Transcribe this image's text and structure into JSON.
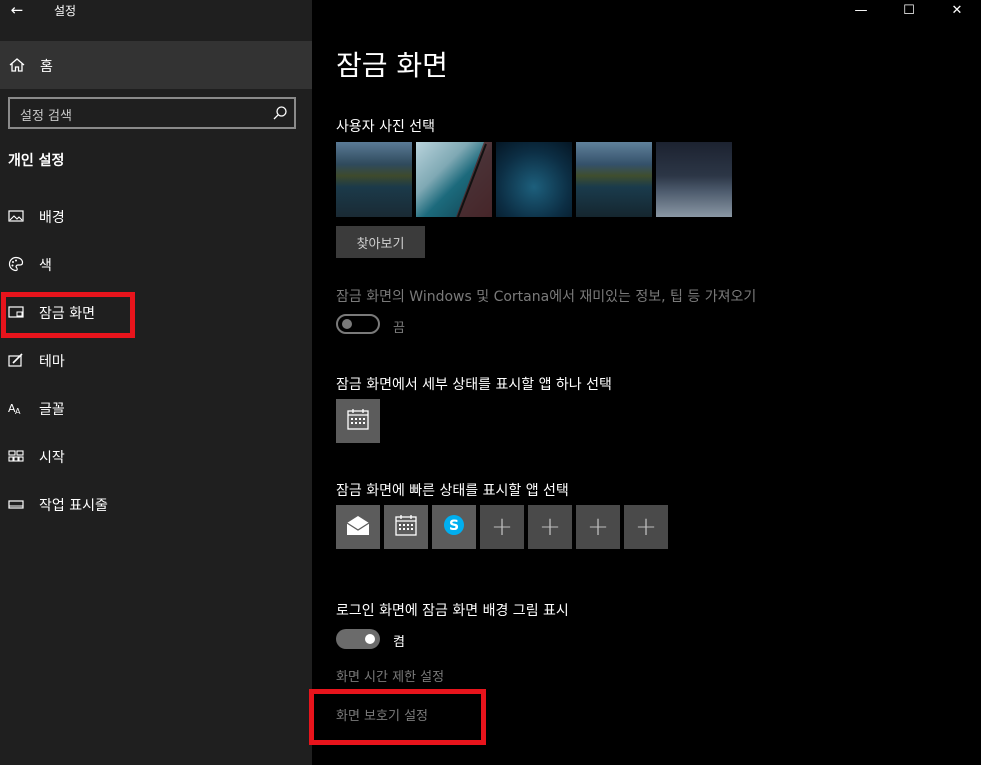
{
  "window": {
    "app_title": "설정",
    "back_glyph": "←",
    "minimize_glyph": "—",
    "maximize_glyph": "☐",
    "close_glyph": "✕"
  },
  "sidebar": {
    "home_label": "홈",
    "search_placeholder": "설정 검색",
    "section_title": "개인 설정",
    "items": [
      {
        "label": "배경",
        "icon": "picture-icon"
      },
      {
        "label": "색",
        "icon": "palette-icon"
      },
      {
        "label": "잠금 화면",
        "icon": "lock-screen-icon",
        "selected": true
      },
      {
        "label": "테마",
        "icon": "theme-icon"
      },
      {
        "label": "글꼴",
        "icon": "font-icon"
      },
      {
        "label": "시작",
        "icon": "start-icon"
      },
      {
        "label": "작업 표시줄",
        "icon": "taskbar-icon"
      }
    ]
  },
  "main": {
    "page_title": "잠금 화면",
    "choose_photo_label": "사용자 사진 선택",
    "browse_button": "찾아보기",
    "fun_facts_label": "잠금 화면의 Windows 및 Cortana에서 재미있는 정보, 팁 등 가져오기",
    "fun_facts_toggle_text": "끔",
    "detailed_status_label": "잠금 화면에서 세부 상태를 표시할 앱 하나 선택",
    "quick_status_label": "잠금 화면에 빠른 상태를 표시할 앱 선택",
    "quick_status_apps": [
      "mail-icon",
      "calendar-icon",
      "skype-icon",
      "add-icon",
      "add-icon",
      "add-icon",
      "add-icon"
    ],
    "signin_bg_label": "로그인 화면에 잠금 화면 배경 그림 표시",
    "signin_bg_toggle_text": "켬",
    "screen_timeout_link": "화면 시간 제한 설정",
    "screensaver_link": "화면 보호기 설정",
    "plus_glyph": "+"
  },
  "colors": {
    "sidebar_bg": "#1f1f1f",
    "main_bg": "#000000",
    "highlight_red": "#e8141c"
  }
}
